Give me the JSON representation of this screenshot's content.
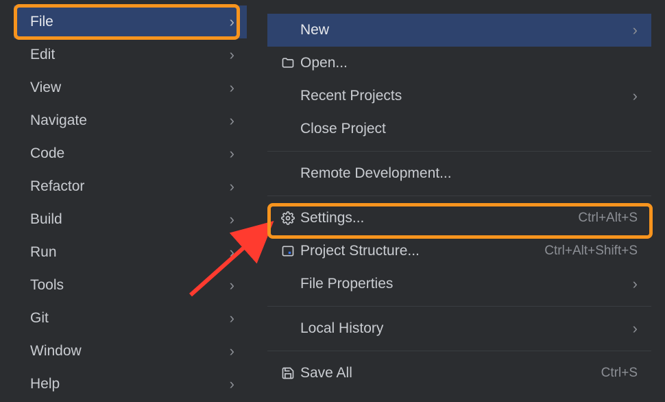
{
  "menubar": {
    "items": [
      {
        "label": "File",
        "has_submenu": true,
        "active": true
      },
      {
        "label": "Edit",
        "has_submenu": true,
        "active": false
      },
      {
        "label": "View",
        "has_submenu": true,
        "active": false
      },
      {
        "label": "Navigate",
        "has_submenu": true,
        "active": false
      },
      {
        "label": "Code",
        "has_submenu": true,
        "active": false
      },
      {
        "label": "Refactor",
        "has_submenu": true,
        "active": false
      },
      {
        "label": "Build",
        "has_submenu": true,
        "active": false
      },
      {
        "label": "Run",
        "has_submenu": true,
        "active": false
      },
      {
        "label": "Tools",
        "has_submenu": true,
        "active": false
      },
      {
        "label": "Git",
        "has_submenu": true,
        "active": false
      },
      {
        "label": "Window",
        "has_submenu": true,
        "active": false
      },
      {
        "label": "Help",
        "has_submenu": true,
        "active": false
      }
    ]
  },
  "submenu": {
    "new": {
      "label": "New"
    },
    "open": {
      "label": "Open..."
    },
    "recent": {
      "label": "Recent Projects"
    },
    "close": {
      "label": "Close Project"
    },
    "remote": {
      "label": "Remote Development..."
    },
    "settings": {
      "label": "Settings...",
      "shortcut": "Ctrl+Alt+S"
    },
    "project_structure": {
      "label": "Project Structure...",
      "shortcut": "Ctrl+Alt+Shift+S"
    },
    "file_properties": {
      "label": "File Properties"
    },
    "local_history": {
      "label": "Local History"
    },
    "save_all": {
      "label": "Save All",
      "shortcut": "Ctrl+S"
    }
  },
  "annotations": {
    "highlight_file": true,
    "highlight_settings": true,
    "arrow_to_settings": true
  }
}
